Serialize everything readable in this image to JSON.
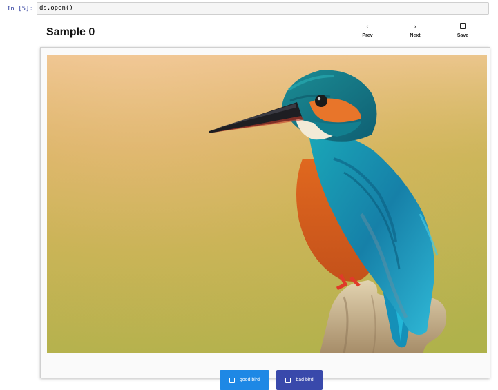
{
  "notebook": {
    "prompt": "In [5]:",
    "code": "ds.open()"
  },
  "viewer": {
    "title": "Sample 0",
    "nav": {
      "prev": {
        "label": "Prev",
        "icon": "chevron-left-icon",
        "glyph": "‹"
      },
      "next": {
        "label": "Next",
        "icon": "chevron-right-icon",
        "glyph": "›"
      },
      "save": {
        "label": "Save",
        "icon": "save-icon"
      }
    },
    "image": {
      "subject": "kingfisher-bird-photo"
    },
    "labels": [
      {
        "text": "good bird",
        "color": "#1e88e5",
        "checked": false
      },
      {
        "text": "bad bird",
        "color": "#3949ab",
        "checked": false
      }
    ]
  }
}
